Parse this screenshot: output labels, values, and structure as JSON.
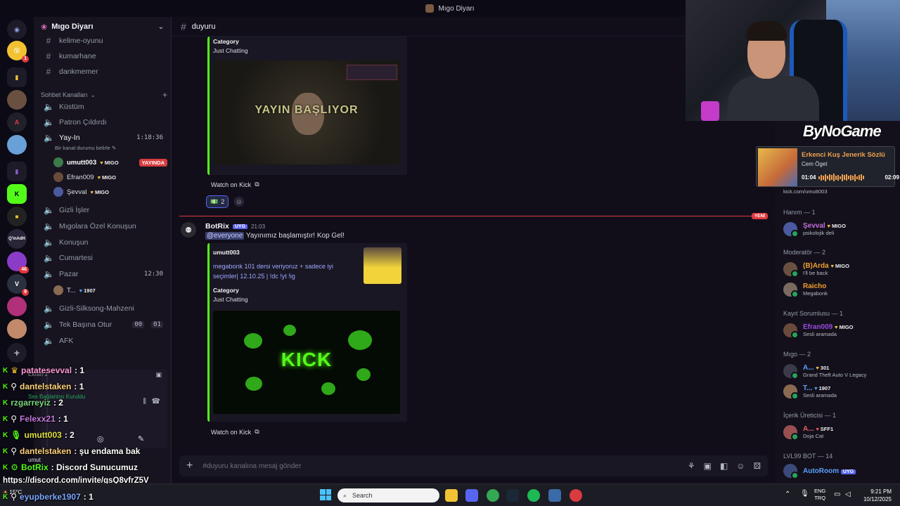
{
  "titlebar": {
    "title": "Mıgo Diyarı"
  },
  "servers": {
    "badges": [
      "1",
      "46",
      "9"
    ],
    "server_labels": [
      "Q'inAdH"
    ]
  },
  "sidebar": {
    "server_name": "Mıgo Diyarı",
    "channels_top": [
      "kelime-oyunu",
      "kumarhane",
      "dankmemer"
    ],
    "category": "Sohbet Kanalları",
    "voice_channels": [
      {
        "name": "Küstüm"
      },
      {
        "name": "Patron Çıldırdı"
      },
      {
        "name": "Yay-In",
        "time": "1:18:36",
        "status": "Bir kanal durumu belirle"
      },
      {
        "name": "Gizli İşler"
      },
      {
        "name": "Mıgolara Özel Konuşun"
      },
      {
        "name": "Konuşun"
      },
      {
        "name": "Cumartesi"
      },
      {
        "name": "Pazar",
        "time": "12:30"
      },
      {
        "name": "Gizli-Silksong-Mahzeni"
      },
      {
        "name": "Tek Başına Otur",
        "count_a": "00",
        "count_b": "01"
      },
      {
        "name": "AFK"
      }
    ],
    "voice_users": [
      {
        "name": "umutt003",
        "tag": "MIGO",
        "live": "YAYINDA"
      },
      {
        "name": "Efran009",
        "tag": "MIGO"
      },
      {
        "name": "Şevval",
        "tag": "MIGO"
      }
    ],
    "pazar_user": {
      "name": "T...",
      "tag": "1907"
    }
  },
  "channel": {
    "name": "duyuru",
    "composer_placeholder": "#duyuru kanalına mesaj gönder"
  },
  "messages": {
    "embed1": {
      "category_label": "Category",
      "category_value": "Just Chatting",
      "thumb_text": "YAYIN BAŞLIYOR",
      "watch_label": "Watch on Kick",
      "reaction_count": "2"
    },
    "new_label": "YENİ",
    "msg2": {
      "author": "BotRix",
      "badge": "UYG",
      "time": "21:03",
      "mention": "@everyone",
      "text": "Yayınımız başlamıştır! Kop Gel!",
      "embed_author": "umutt003",
      "embed_title": "megabonk 101 dersi veriyoruz + sadece iyi seçimler| 12.10.25 | !dc !yt !ig",
      "category_label": "Category",
      "category_value": "Just Chatting",
      "image_text": "KICK",
      "watch_label": "Watch on Kick"
    }
  },
  "overlay": {
    "logo": "ByNoGame",
    "now_playing": {
      "title": "Erkenci Kuş Jenerik Sözlü",
      "artist": "Cem Öget",
      "elapsed": "01:04",
      "total": "02:09"
    },
    "chat": [
      {
        "user": "patatesevval",
        "text": ": 1"
      },
      {
        "user": "dantelstaken",
        "text": ": 1"
      },
      {
        "user": "rzgarreyiz",
        "text": ": 2"
      },
      {
        "user": "Felexx21",
        "text": ": 1"
      },
      {
        "user": "umutt003",
        "text": ": 2"
      },
      {
        "user": "dantelstaken",
        "text": ": şu endama bak"
      },
      {
        "user": "BotRix",
        "text": ": Discord Sunucumuz"
      },
      {
        "user": "",
        "text": "https://discord.com/invite/gsQ8vfrZ5V"
      },
      {
        "user": "eyupberke1907",
        "text": ": 1"
      }
    ],
    "under_chat": [
      "Ekran 1",
      "Ses Bağlantısı Kuruldu",
      "umut"
    ]
  },
  "members": {
    "groups": [
      {
        "label": "Hanım — 1",
        "members": [
          {
            "name": "Şevval",
            "tag": "MIGO",
            "status": "psikolojik deli",
            "color": "#c16fd9"
          }
        ]
      },
      {
        "label": "Moderatör — 2",
        "members": [
          {
            "name": "(B)Arda",
            "tag": "MIGO",
            "status": "I'll be back",
            "color": "#f0a030"
          },
          {
            "name": "Raicho",
            "tag": "",
            "status": "Megabonk",
            "color": "#f0a030"
          }
        ]
      },
      {
        "label": "Kayıt Sorumlusu — 1",
        "members": [
          {
            "name": "Efran009",
            "tag": "MIGO",
            "status": "Sesli aramada",
            "color": "#9a4be0"
          }
        ]
      },
      {
        "label": "Mıgo — 2",
        "members": [
          {
            "name": "A...",
            "tag": "301",
            "status": "Grand Theft Auto V Legacy",
            "color": "#5aa0ff"
          },
          {
            "name": "T...",
            "tag": "1907",
            "status": "Sesli aramada",
            "color": "#5aa0ff"
          }
        ]
      },
      {
        "label": "İçerik Üreticisi — 1",
        "members": [
          {
            "name": "A...",
            "tag": "SFF1",
            "status": "Doja Cat",
            "color": "#e06060"
          }
        ]
      },
      {
        "label": "LVL99 BOT — 14",
        "members": [
          {
            "name": "AutoRoom",
            "tag": "UYG",
            "status": "",
            "color": "#5aa0ff"
          }
        ]
      }
    ],
    "hidden_top": "kick.com/umutt003"
  },
  "taskbar": {
    "search": "Search",
    "lang_top": "ENG",
    "lang_bottom": "TRQ",
    "time": "9:21 PM",
    "date": "10/12/2025",
    "weather": "15°C"
  }
}
